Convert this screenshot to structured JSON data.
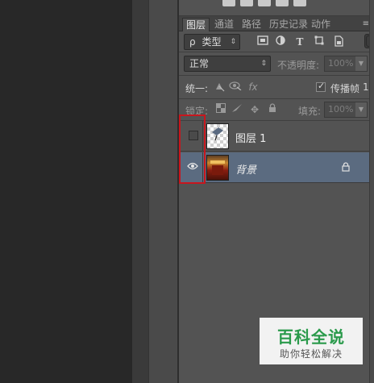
{
  "panel": {
    "tabs": [
      "图层",
      "通道",
      "路径",
      "历史记录",
      "动作"
    ],
    "filter": {
      "kind_label": "类型",
      "search_prefix": "ρ"
    },
    "blend_mode": "正常",
    "opacity_label": "不透明度:",
    "opacity_value": "100%",
    "unify_label": "统一:",
    "propagate_label": "传播帧",
    "propagate_value": "1",
    "lock_label": "锁定:",
    "fill_label": "填充:",
    "fill_value": "100%"
  },
  "layers": [
    {
      "name": "图层 1",
      "visible": false,
      "thumbnail": "transparent-checker",
      "locked": false
    },
    {
      "name": "背景",
      "visible": true,
      "thumbnail": "photo",
      "locked": true
    }
  ],
  "watermark": {
    "title": "百科全说",
    "subtitle": "助你轻松解决"
  },
  "colors": {
    "selection": "#5b6b80",
    "highlight": "#c8161d",
    "watermark_green": "#2a9a4b"
  }
}
